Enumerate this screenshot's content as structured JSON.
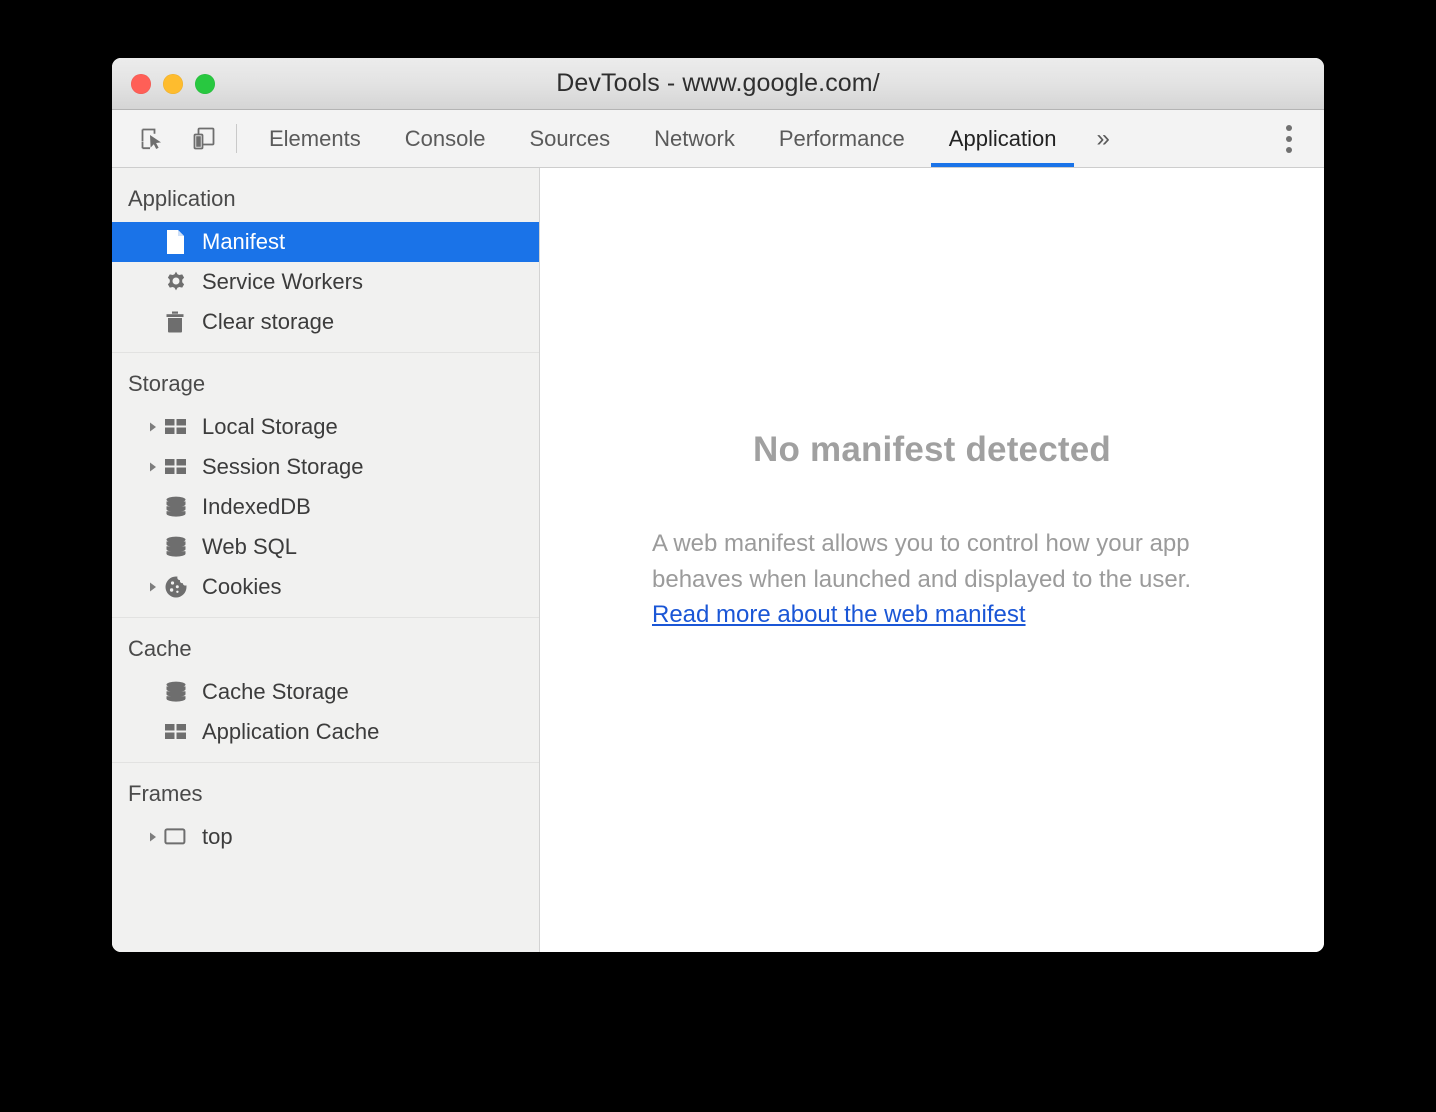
{
  "window": {
    "title": "DevTools - www.google.com/",
    "traffic_lights": [
      {
        "name": "close",
        "color": "#ff5f57"
      },
      {
        "name": "minimize",
        "color": "#febc2e"
      },
      {
        "name": "zoom",
        "color": "#28c840"
      }
    ]
  },
  "toolbar": {
    "inspect_icon": "inspect-element-cursor-icon",
    "device_toolbar_icon": "toggle-device-toolbar-icon",
    "more_tabs_label": "»",
    "kebab_icon": "more-options-icon",
    "tabs": [
      {
        "label": "Elements",
        "active": false
      },
      {
        "label": "Console",
        "active": false
      },
      {
        "label": "Sources",
        "active": false
      },
      {
        "label": "Network",
        "active": false
      },
      {
        "label": "Performance",
        "active": false
      },
      {
        "label": "Application",
        "active": true
      }
    ]
  },
  "sidebar": {
    "sections": [
      {
        "title": "Application",
        "items": [
          {
            "label": "Manifest",
            "icon": "document-icon",
            "selected": true,
            "twisty": false
          },
          {
            "label": "Service Workers",
            "icon": "gear-icon",
            "selected": false,
            "twisty": false
          },
          {
            "label": "Clear storage",
            "icon": "trash-icon",
            "selected": false,
            "twisty": false
          }
        ]
      },
      {
        "title": "Storage",
        "items": [
          {
            "label": "Local Storage",
            "icon": "table-icon",
            "selected": false,
            "twisty": true
          },
          {
            "label": "Session Storage",
            "icon": "table-icon",
            "selected": false,
            "twisty": true
          },
          {
            "label": "IndexedDB",
            "icon": "database-icon",
            "selected": false,
            "twisty": false
          },
          {
            "label": "Web SQL",
            "icon": "database-icon",
            "selected": false,
            "twisty": false
          },
          {
            "label": "Cookies",
            "icon": "cookie-icon",
            "selected": false,
            "twisty": true
          }
        ]
      },
      {
        "title": "Cache",
        "items": [
          {
            "label": "Cache Storage",
            "icon": "database-icon",
            "selected": false,
            "twisty": false
          },
          {
            "label": "Application Cache",
            "icon": "table-icon",
            "selected": false,
            "twisty": false
          }
        ]
      },
      {
        "title": "Frames",
        "items": [
          {
            "label": "top",
            "icon": "frame-icon",
            "selected": false,
            "twisty": true
          }
        ]
      }
    ]
  },
  "main": {
    "empty_title": "No manifest detected",
    "empty_description": "A web manifest allows you to control how your app behaves when launched and displayed to the user.",
    "empty_link": "Read more about the web manifest"
  },
  "colors": {
    "accent_blue": "#1a73e8",
    "link_blue": "#1a56d6",
    "sidebar_bg": "#f1f1f0",
    "toolbar_bg": "#f3f3f3",
    "icon_gray": "#6e6e6e",
    "muted_text": "#9b9b9b"
  }
}
